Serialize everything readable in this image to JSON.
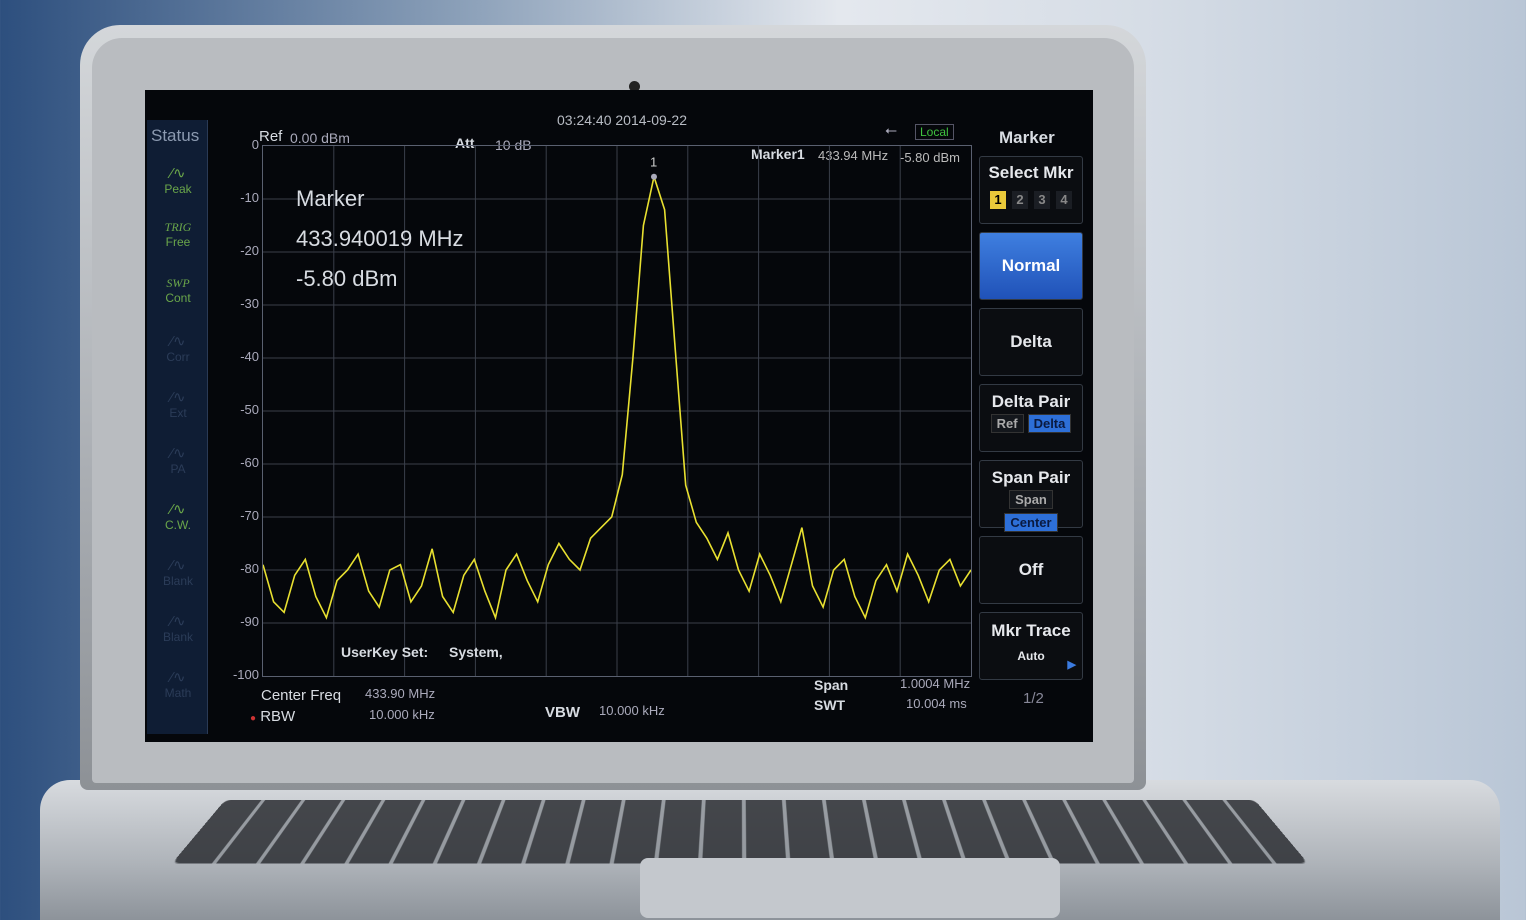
{
  "header": {
    "datetime": "03:24:40 2014-09-22",
    "remote_status": "Local",
    "usb_icon": "usb-icon",
    "ref_label": "Ref",
    "ref_value": "0.00 dBm",
    "att_label": "Att",
    "att_value": "10 dB",
    "marker_readout": {
      "label": "Marker1",
      "freq": "433.94 MHz",
      "level": "-5.80 dBm"
    }
  },
  "status_panel": {
    "title": "Status",
    "items": [
      {
        "label": "Peak",
        "sub": "",
        "state": "on",
        "icon": "peak-wave-icon"
      },
      {
        "label": "Free",
        "sub": "TRIG",
        "state": "on",
        "icon": ""
      },
      {
        "label": "Cont",
        "sub": "SWP",
        "state": "on",
        "icon": ""
      },
      {
        "label": "Corr",
        "sub": "",
        "state": "off",
        "icon": "corr-wave-icon"
      },
      {
        "label": "Ext",
        "sub": "",
        "state": "off",
        "icon": "ext-wave-icon"
      },
      {
        "label": "PA",
        "sub": "",
        "state": "off",
        "icon": "pa-icon"
      },
      {
        "label": "C.W.",
        "sub": "",
        "state": "on",
        "icon": "cw-wave-icon"
      },
      {
        "label": "Blank",
        "sub": "",
        "state": "off",
        "icon": "blank-wave-icon"
      },
      {
        "label": "Blank",
        "sub": "",
        "state": "off",
        "icon": "blank-wave-icon"
      },
      {
        "label": "Math",
        "sub": "",
        "state": "off",
        "icon": "math-wave-icon"
      }
    ]
  },
  "marker_box": {
    "title": "Marker",
    "freq": "433.940019 MHz",
    "level": "-5.80 dBm"
  },
  "userkey": {
    "label": "UserKey Set:",
    "value": "System,"
  },
  "footer": {
    "center_label": "Center Freq",
    "center_value": "433.90 MHz",
    "rbw_label": "RBW",
    "rbw_value": "10.000 kHz",
    "vbw_label": "VBW",
    "vbw_value": "10.000 kHz",
    "span_label": "Span",
    "span_value": "1.0004 MHz",
    "swt_label": "SWT",
    "swt_value": "10.004 ms"
  },
  "softkeys": {
    "title": "Marker",
    "select_label": "Select Mkr",
    "markers": [
      "1",
      "2",
      "3",
      "4"
    ],
    "selected_marker": "1",
    "normal": "Normal",
    "delta": "Delta",
    "delta_pair": "Delta Pair",
    "delta_pair_opts": [
      "Ref",
      "Delta"
    ],
    "span_pair": "Span Pair",
    "span_pair_opts": [
      "Span",
      "Center"
    ],
    "off": "Off",
    "mkr_trace": "Mkr Trace",
    "mkr_trace_value": "Auto",
    "page": "1/2"
  },
  "colors": {
    "trace": "#e8e030",
    "active_key": "#2f6bd6",
    "status_on": "#6aa64a"
  },
  "chart_data": {
    "type": "line",
    "ylim": [
      -100,
      0
    ],
    "yticks": [
      "0",
      "-10",
      "-20",
      "-30",
      "-40",
      "-50",
      "-60",
      "-70",
      "-80",
      "-90",
      "-100"
    ],
    "xlim_mhz": [
      433.3998,
      434.4002
    ],
    "grid": true,
    "marker_label": "1",
    "trace_dbm": [
      -79,
      -86,
      -88,
      -81,
      -78,
      -85,
      -89,
      -82,
      -80,
      -77,
      -84,
      -87,
      -80,
      -79,
      -86,
      -83,
      -76,
      -85,
      -88,
      -81,
      -78,
      -84,
      -89,
      -80,
      -77,
      -82,
      -86,
      -79,
      -75,
      -78,
      -80,
      -74,
      -72,
      -70,
      -62,
      -40,
      -15,
      -5.8,
      -12,
      -38,
      -64,
      -71,
      -74,
      -78,
      -73,
      -80,
      -84,
      -77,
      -81,
      -86,
      -79,
      -72,
      -83,
      -87,
      -80,
      -78,
      -85,
      -89,
      -82,
      -79,
      -84,
      -77,
      -81,
      -86,
      -80,
      -78,
      -83,
      -80
    ]
  }
}
